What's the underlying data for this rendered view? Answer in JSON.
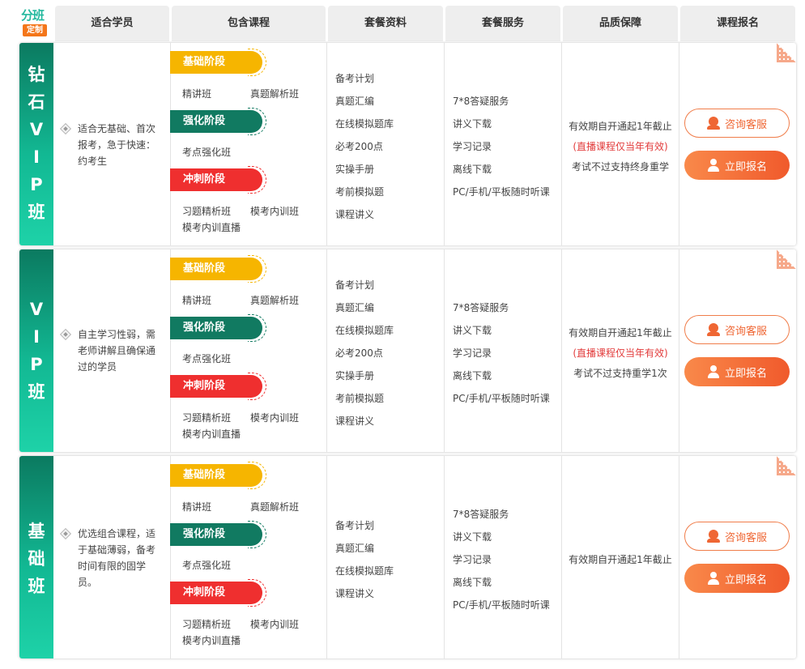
{
  "logo": {
    "line1": "分班",
    "line2": "定制"
  },
  "header": [
    "适合学员",
    "包含课程",
    "套餐资料",
    "套餐服务",
    "品质保障",
    "课程报名"
  ],
  "rows": [
    {
      "title_chars": [
        "钻",
        "石",
        "V",
        "I",
        "P",
        "班"
      ],
      "suitable": "适合无基础、首次报考，急于快速：　 约考生",
      "stages": {
        "basic": "基础阶段",
        "strong": "强化阶段",
        "sprint": "冲刺阶段",
        "basic_courses": [
          "精讲班",
          "真题解析班"
        ],
        "strong_courses": [
          "考点强化班"
        ],
        "sprint_courses": [
          "习题精析班",
          "模考内训班",
          "模考内训直播"
        ]
      },
      "materials": [
        "备考计划",
        "真题汇编",
        "在线模拟题库",
        "必考200点",
        "实操手册",
        "考前模拟题",
        "课程讲义"
      ],
      "services": [
        "7*8答疑服务",
        "讲义下载",
        "学习记录",
        "离线下载",
        "PC/手机/平板随时听课"
      ],
      "quality": [
        "有效期自开通起1年截止",
        "(直播课程仅当年有效)",
        "考试不过支持终身重学"
      ],
      "consult": "咨询客服",
      "signup": "立即报名"
    },
    {
      "title_chars": [
        "V",
        "I",
        "P",
        "班"
      ],
      "suitable": "自主学习性弱，需老师讲解且确保通过的学员",
      "stages": {
        "basic": "基础阶段",
        "strong": "强化阶段",
        "sprint": "冲刺阶段",
        "basic_courses": [
          "精讲班",
          "真题解析班"
        ],
        "strong_courses": [
          "考点强化班"
        ],
        "sprint_courses": [
          "习题精析班",
          "模考内训班",
          "模考内训直播"
        ]
      },
      "materials": [
        "备考计划",
        "真题汇编",
        "在线模拟题库",
        "必考200点",
        "实操手册",
        "考前模拟题",
        "课程讲义"
      ],
      "services": [
        "7*8答疑服务",
        "讲义下载",
        "学习记录",
        "离线下载",
        "PC/手机/平板随时听课"
      ],
      "quality": [
        "有效期自开通起1年截止",
        "(直播课程仅当年有效)",
        "考试不过支持重学1次"
      ],
      "consult": "咨询客服",
      "signup": "立即报名"
    },
    {
      "title_chars": [
        "基",
        "础",
        "班"
      ],
      "suitable": "优选组合课程，适于基础薄弱，备考时间有限的固学员。",
      "stages": {
        "basic": "基础阶段",
        "strong": "强化阶段",
        "sprint": "冲刺阶段",
        "basic_courses": [
          "精讲班",
          "真题解析班"
        ],
        "strong_courses": [
          "考点强化班"
        ],
        "sprint_courses": [
          "习题精析班",
          "模考内训班",
          "模考内训直播"
        ]
      },
      "materials": [
        "备考计划",
        "真题汇编",
        "在线模拟题库",
        "课程讲义"
      ],
      "services": [
        "7*8答疑服务",
        "讲义下载",
        "学习记录",
        "离线下载",
        "PC/手机/平板随时听课"
      ],
      "quality": [
        "有效期自开通起1年截止"
      ],
      "consult": "咨询客服",
      "signup": "立即报名"
    }
  ],
  "colors": {
    "band": "#12b893",
    "basic": "#f6b500",
    "strong": "#117a61",
    "sprint": "#ef2f2f",
    "accent": "#f05a2c"
  },
  "icons": {
    "consult": "customer-service-icon",
    "signup": "user-icon",
    "suitable": "diamond-bullet-icon"
  }
}
